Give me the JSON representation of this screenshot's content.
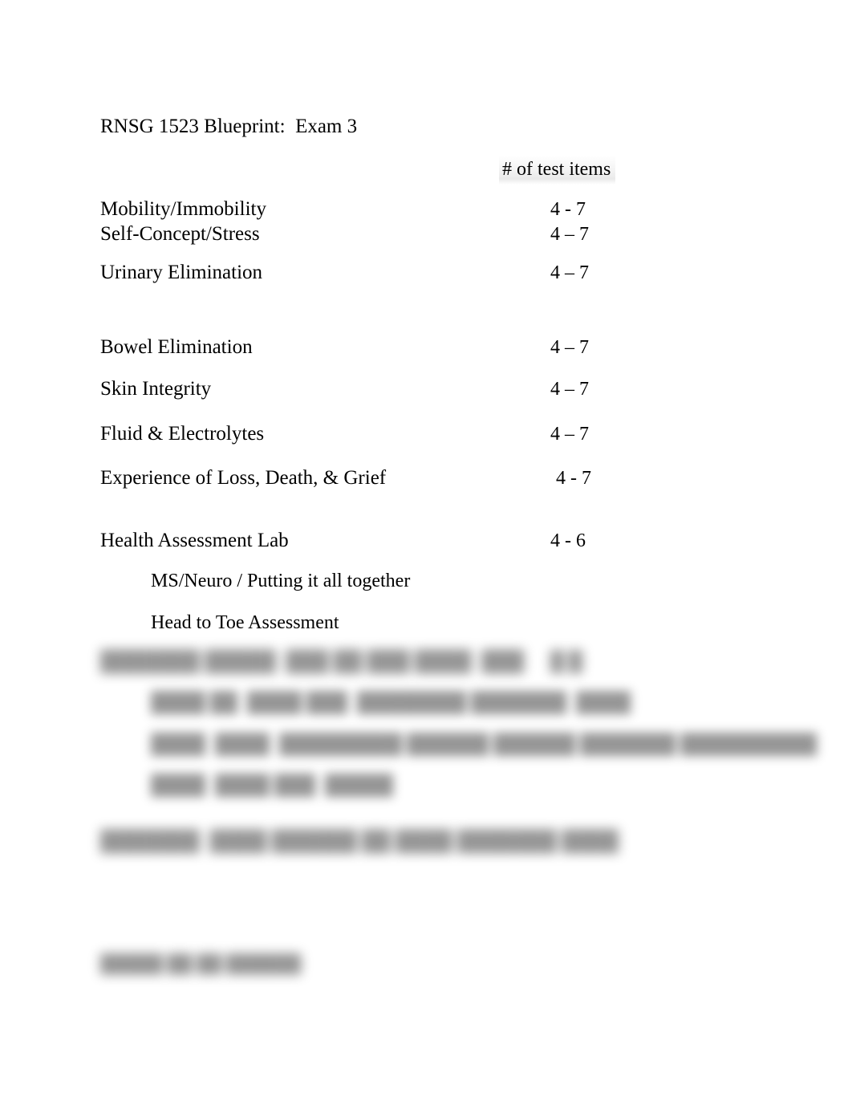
{
  "document": {
    "title": "RNSG 1523 Blueprint:  Exam 3",
    "column_header": "# of test items",
    "background_color": "#ffffff",
    "text_color": "#000000",
    "header_highlight_color": "#f0f0f0"
  },
  "rows": [
    {
      "label": "Mobility/Immobility",
      "count": "4 - 7"
    },
    {
      "label": "Self-Concept/Stress",
      "count": "4 – 7"
    },
    {
      "label": "Urinary Elimination",
      "count": "4 – 7"
    },
    {
      "label": "Bowel Elimination",
      "count": "4 – 7"
    },
    {
      "label": "Skin Integrity",
      "count": "4 – 7"
    },
    {
      "label": "Fluid & Electrolytes",
      "count": "4 – 7"
    },
    {
      "label": "Experience of Loss, Death, & Grief",
      "count": "4 - 7"
    },
    {
      "label": "Health Assessment Lab",
      "count": "4 - 6"
    }
  ],
  "sub_items": [
    {
      "label": "MS/Neuro / Putting it all together"
    },
    {
      "label": "Head to Toe Assessment"
    }
  ],
  "redacted": {
    "note": "illegible blurred text",
    "section_heading": {
      "label": "███████ █████  ███ ██ ███ ████  ███",
      "count": "█ █"
    },
    "section_items": [
      {
        "label": "████ ██  ████ ███  ████████ ███████  ████"
      },
      {
        "label": "████  ████  █████████ ██████ ██████ ███████ ██████████"
      },
      {
        "label": "████  ████ ███  █████"
      }
    ],
    "extra_row": {
      "label": "███████  ████ ██████ ██ ████ ███████ ████",
      "count": "█ █"
    },
    "footer": {
      "label": "█████ ██ ██ ██████"
    }
  }
}
